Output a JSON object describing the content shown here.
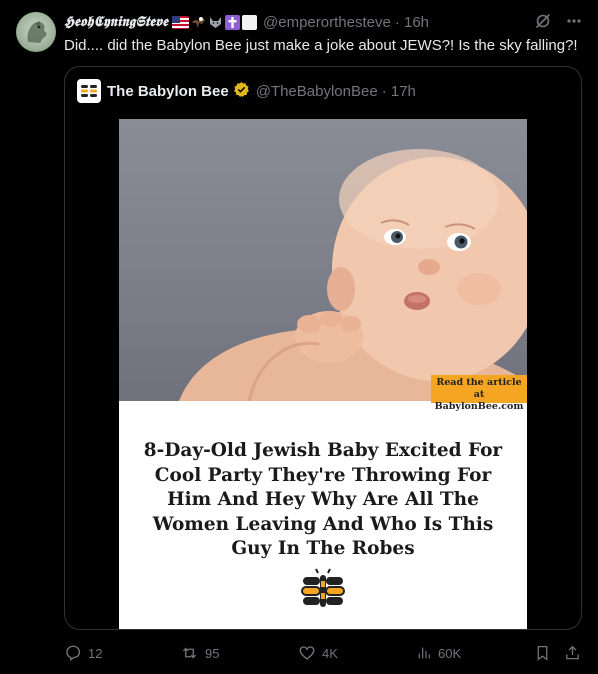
{
  "tweet": {
    "display_name": "𝕳𝖊𝖔𝖍𝕮𝖞𝖓𝖎𝖓𝖌𝕾𝖙𝖊𝖛𝖊",
    "handle": "@emperorthesteve",
    "time": "· 16h",
    "text": "Did.... did the Babylon Bee just make a joke about JEWS?! Is the sky falling?!"
  },
  "quote": {
    "name": "The Babylon Bee",
    "handle": "@TheBabylonBee",
    "time": "· 17h",
    "badge_line1": "Read the article at",
    "badge_line2": "BabylonBee.com",
    "headline": "8-Day-Old Jewish Baby Excited For Cool Party They're Throwing For Him And Hey Why Are All The Women Leaving And Who Is This Guy In The Robes"
  },
  "actions": {
    "replies": "12",
    "reposts": "95",
    "likes": "4K",
    "views": "60K"
  },
  "icons": [
    "avatar",
    "flag-us-icon",
    "eagle-icon",
    "wolf-icon",
    "cross-icon",
    "blank-icon",
    "grok-icon",
    "more-icon",
    "verified-icon",
    "reply-icon",
    "repost-icon",
    "like-icon",
    "views-icon",
    "bookmark-icon",
    "share-icon"
  ],
  "colors": {
    "background": "#000000",
    "text": "#e7e9ea",
    "secondary": "#71767b",
    "border": "#2f3336",
    "verified": "#e2b719",
    "badge": "#f4a623"
  }
}
